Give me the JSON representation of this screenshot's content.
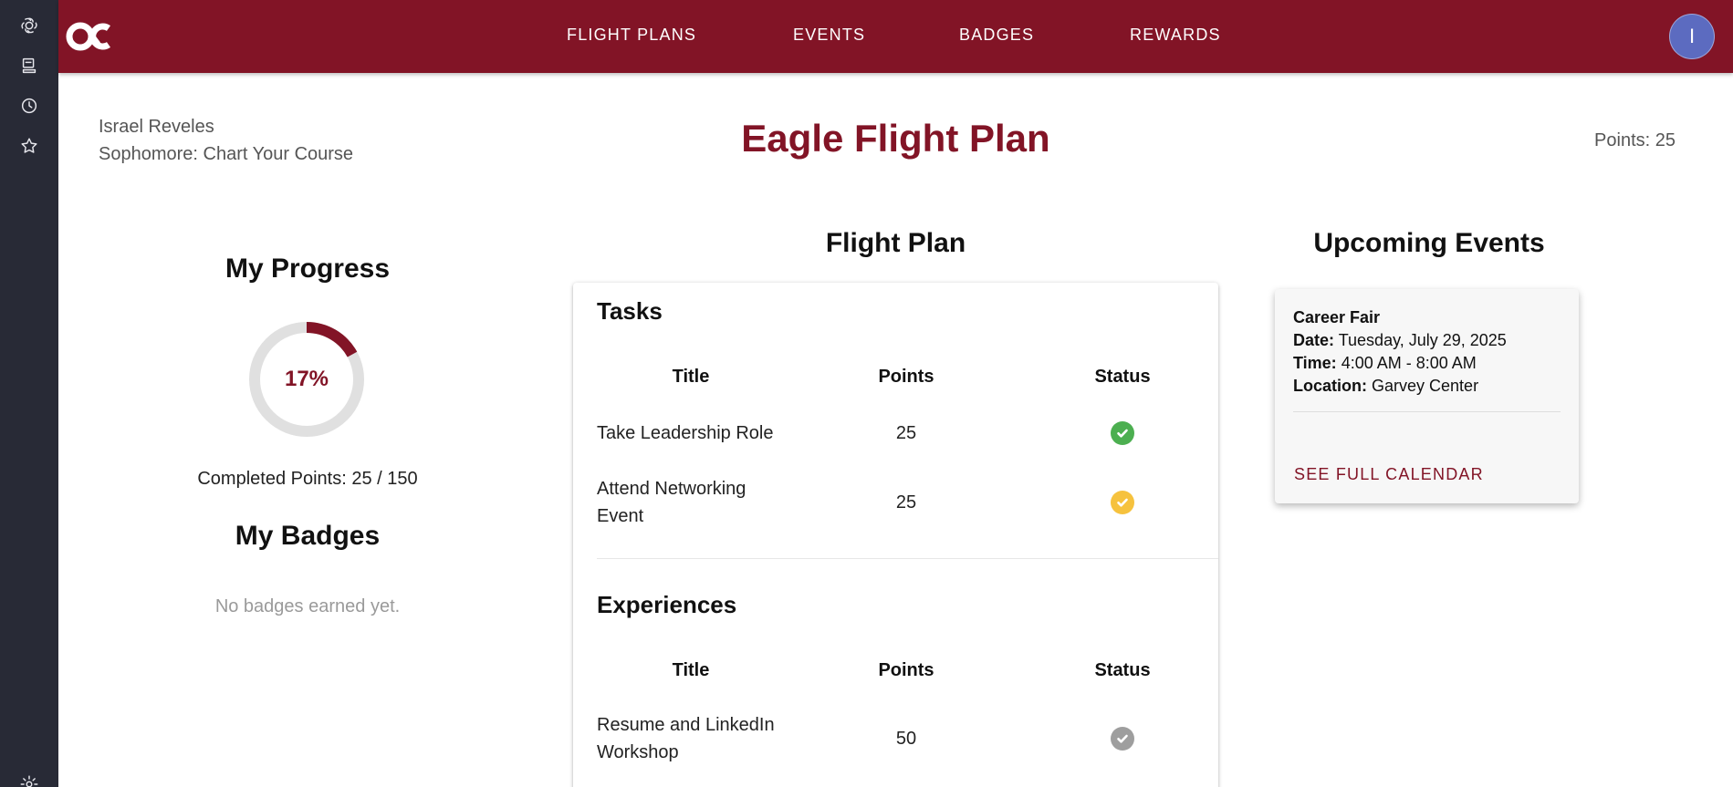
{
  "nav": {
    "items": [
      {
        "label": "FLIGHT PLANS"
      },
      {
        "label": "EVENTS"
      },
      {
        "label": "BADGES"
      },
      {
        "label": "REWARDS"
      }
    ],
    "avatar_initial": "I"
  },
  "rail": {
    "icons": [
      "openai-icon",
      "archive-icon",
      "history-icon",
      "star-icon",
      "settings-icon"
    ]
  },
  "header": {
    "user_name": "Israel Reveles",
    "user_level": "Sophomore: Chart Your Course",
    "title": "Eagle Flight Plan",
    "points": "Points: 25"
  },
  "progress": {
    "heading": "My Progress",
    "percent_label": "17%",
    "fraction": 0.17,
    "completed_text": "Completed Points: 25 / 150"
  },
  "badges": {
    "heading": "My Badges",
    "empty_text": "No badges earned yet."
  },
  "flight_plan": {
    "heading": "Flight Plan",
    "tasks": {
      "heading": "Tasks",
      "columns": [
        "Title",
        "Points",
        "Status"
      ],
      "rows": [
        {
          "title": "Take Leadership Role",
          "points": "25",
          "status": "completed"
        },
        {
          "title": "Attend Networking Event",
          "points": "25",
          "status": "pending"
        }
      ]
    },
    "experiences": {
      "heading": "Experiences",
      "columns": [
        "Title",
        "Points",
        "Status"
      ],
      "rows": [
        {
          "title": "Resume and LinkedIn Workshop",
          "points": "50",
          "status": "not-started"
        }
      ]
    }
  },
  "events": {
    "heading": "Upcoming Events",
    "card": {
      "name": "Career Fair",
      "date_label": "Date:",
      "date": "Tuesday, July 29, 2025",
      "time_label": "Time:",
      "time": "4:00 AM - 8:00 AM",
      "location_label": "Location:",
      "location": "Garvey Center"
    },
    "calendar_link": "SEE FULL CALENDAR"
  },
  "colors": {
    "brand": "#821426",
    "status_completed": "#4caf50",
    "status_pending": "#f6c23e",
    "status_not_started": "#9e9e9e"
  }
}
